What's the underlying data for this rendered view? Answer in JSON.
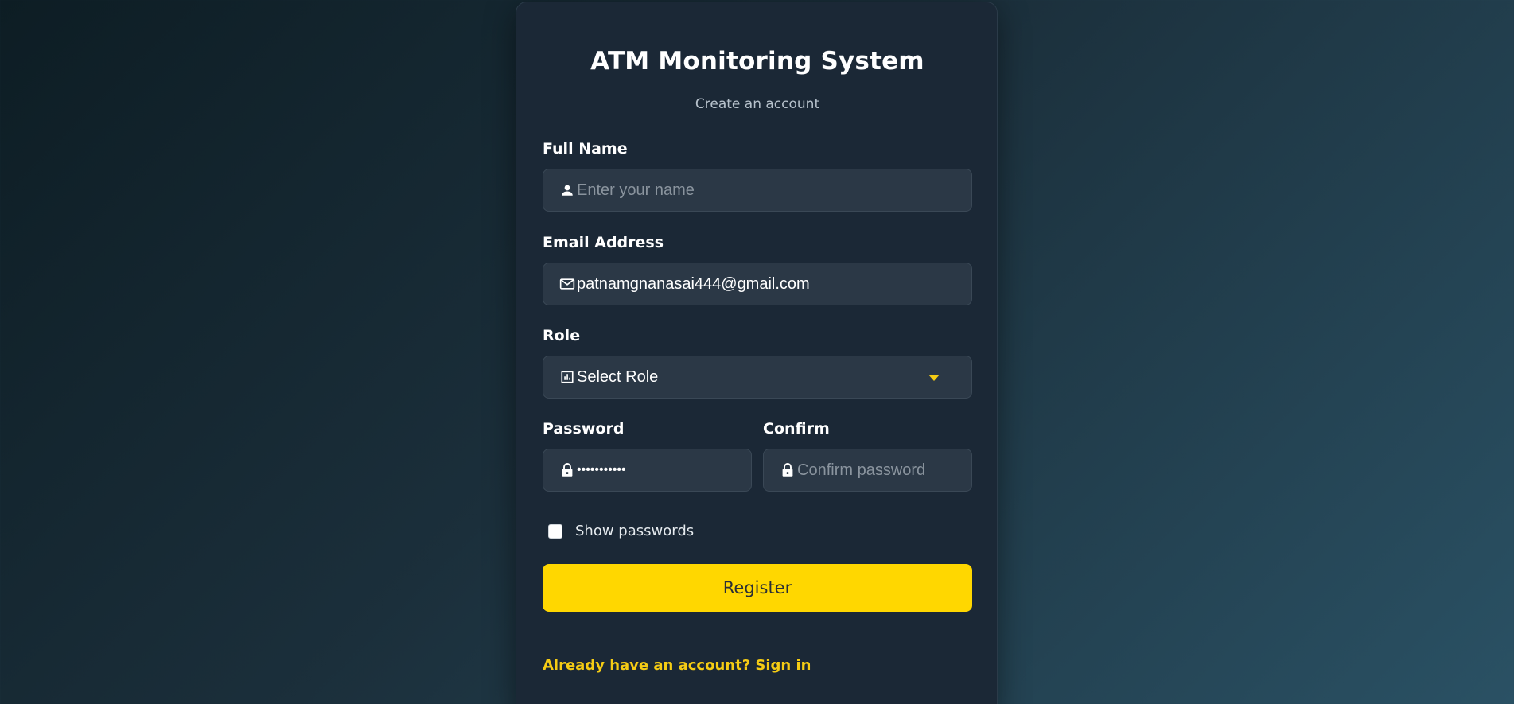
{
  "header": {
    "title": "ATM Monitoring System",
    "subtitle": "Create an account"
  },
  "form": {
    "full_name": {
      "label": "Full Name",
      "value": "",
      "placeholder": "Enter your name",
      "icon": "user-icon"
    },
    "email": {
      "label": "Email Address",
      "value": "patnamgnanasai444@gmail.com",
      "placeholder": "",
      "icon": "mail-icon"
    },
    "role": {
      "label": "Role",
      "selected": "Select Role",
      "icon": "chart-icon"
    },
    "password": {
      "label": "Password",
      "value": "•••••••••••",
      "icon": "lock-icon"
    },
    "confirm": {
      "label": "Confirm",
      "value": "",
      "placeholder": "Confirm password",
      "icon": "lock-icon"
    },
    "show_passwords": {
      "label": "Show passwords",
      "checked": false
    },
    "register_label": "Register",
    "signin_link": "Already have an account? Sign in"
  },
  "colors": {
    "accent": "#ffd700",
    "card": "#1b2836",
    "field": "#2b3846"
  }
}
